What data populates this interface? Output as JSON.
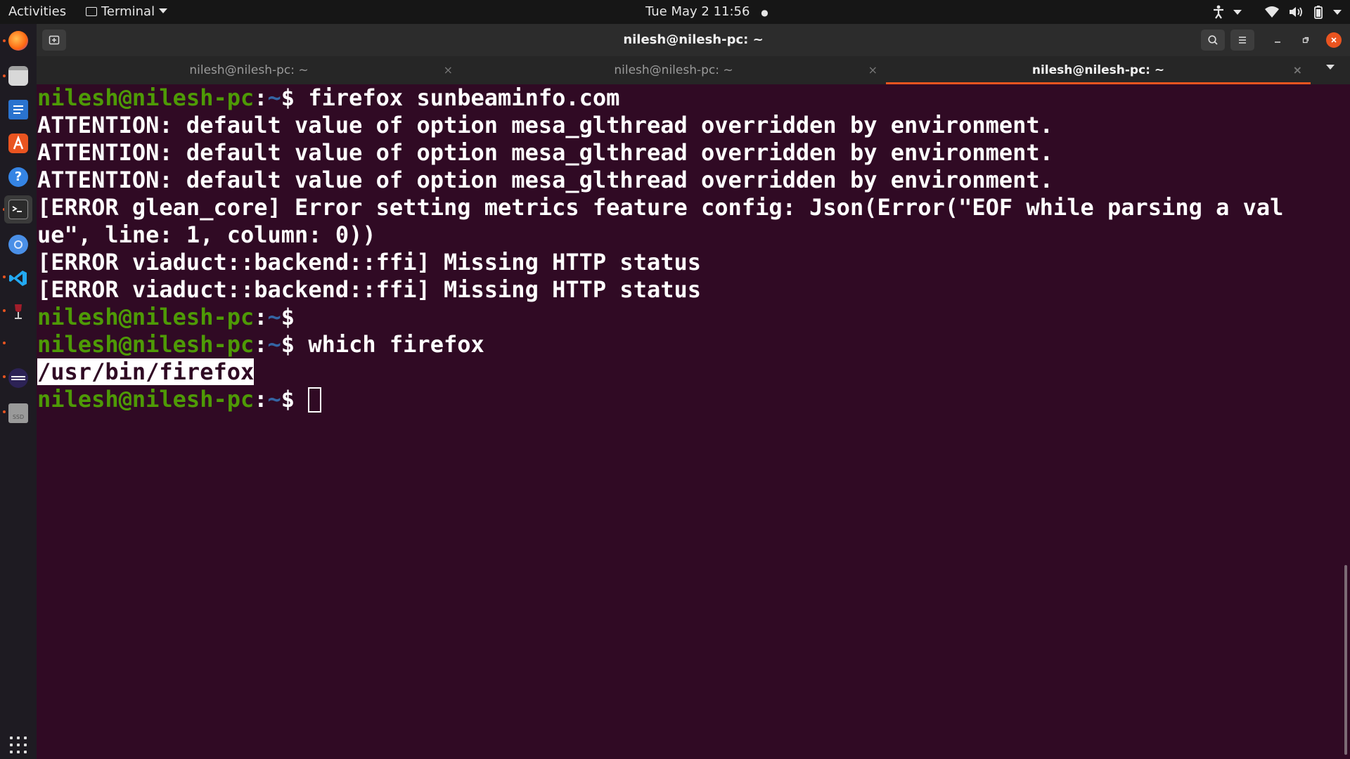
{
  "topbar": {
    "activities": "Activities",
    "app_name": "Terminal",
    "clock": "Tue May 2  11:56",
    "notification_dot": "●"
  },
  "dock": {
    "apps": [
      "firefox-icon",
      "files-icon",
      "libreoffice-writer-icon",
      "software-center-icon",
      "help-icon",
      "terminal-icon",
      "chromium-icon",
      "vscode-icon",
      "wine-icon",
      "eclipse-icon",
      "disk-icon"
    ]
  },
  "window": {
    "title": "nilesh@nilesh-pc: ~",
    "tabs": [
      {
        "label": "nilesh@nilesh-pc: ~",
        "close": "×"
      },
      {
        "label": "nilesh@nilesh-pc: ~",
        "close": "×"
      },
      {
        "label": "nilesh@nilesh-pc: ~",
        "close": "×"
      }
    ]
  },
  "terminal": {
    "user_host": "nilesh@nilesh-pc",
    "colon": ":",
    "path": "~",
    "dollar": "$ ",
    "cmd1": "firefox sunbeaminfo.com",
    "out1": "ATTENTION: default value of option mesa_glthread overridden by environment.",
    "out2": "ATTENTION: default value of option mesa_glthread overridden by environment.",
    "out3": "ATTENTION: default value of option mesa_glthread overridden by environment.",
    "out4a": "[ERROR glean_core] Error setting metrics feature config: Json(Error(\"EOF while parsing a val",
    "out4b": "ue\", line: 1, column: 0))",
    "out5": "[ERROR viaduct::backend::ffi] Missing HTTP status",
    "out6": "[ERROR viaduct::backend::ffi] Missing HTTP status",
    "cmd2": "",
    "cmd3": "which firefox",
    "out7": "/usr/bin/firefox"
  },
  "colors": {
    "terminal_bg": "#300a24",
    "prompt_green": "#4e9a06",
    "path_blue": "#3465a4",
    "accent": "#e95420"
  }
}
